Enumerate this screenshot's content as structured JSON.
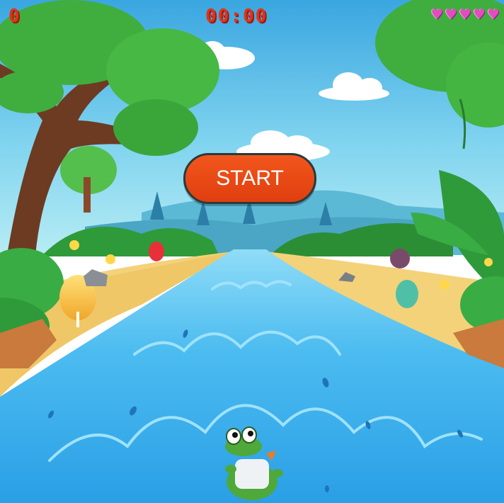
{
  "hud": {
    "score": "0",
    "timer": "00:00",
    "lives": 5,
    "heart_glyph": "♥"
  },
  "start_button": {
    "label": "START"
  },
  "scene": {
    "sky_top": "#3aa6e0",
    "sky_bottom": "#a9e6f2",
    "river_color": "#3fb2ee",
    "sand_color": "#f3d27a",
    "foliage_color": "#2f9a3a",
    "player": "crocodile-character"
  },
  "colors": {
    "hud_text": "#e0331c",
    "heart": "#e24cc0",
    "button": "#f2561c"
  }
}
